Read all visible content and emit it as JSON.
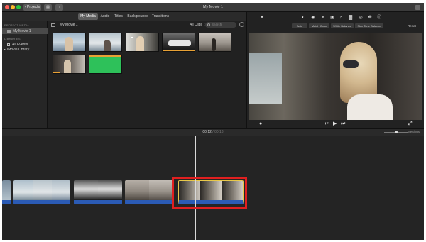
{
  "window": {
    "title": "My Movie 1",
    "projects_button": "Projects"
  },
  "browser_tabs": [
    "My Media",
    "Audio",
    "Titles",
    "Backgrounds",
    "Transitions"
  ],
  "sidebar": {
    "project_media_heading": "PROJECT MEDIA",
    "project_item": "My Movie 1",
    "libraries_heading": "LIBRARIES",
    "all_events": "All Events",
    "library": "iMovie Library"
  },
  "browser": {
    "title": "My Movie 1",
    "clips_filter": "All Clips",
    "search_placeholder": "Search"
  },
  "viewer": {
    "color_buttons": [
      "Auto",
      "Match Color",
      "White Balance",
      "Skin Tone Balance"
    ],
    "reset": "Reset"
  },
  "timeline": {
    "current_time": "00:12",
    "separator": "/",
    "duration": "00:18",
    "settings": "Settings"
  },
  "colors": {
    "accent_blue": "#2b5bb5",
    "highlight_red": "#e01f1f",
    "clip_selected_yellow": "#e8c84a"
  },
  "icons": {
    "title_bar": [
      "share-icon",
      "fullscreen-icon"
    ],
    "viewer_tools": [
      "magic-wand-icon",
      "color-balance-icon",
      "color-correction-icon",
      "crop-icon",
      "stabilization-icon",
      "volume-icon",
      "noise-reduction-icon",
      "speed-icon",
      "filter-icon",
      "info-icon"
    ],
    "playback": [
      "microphone-icon",
      "skip-back-icon",
      "play-icon",
      "skip-forward-icon",
      "expand-icon"
    ]
  }
}
